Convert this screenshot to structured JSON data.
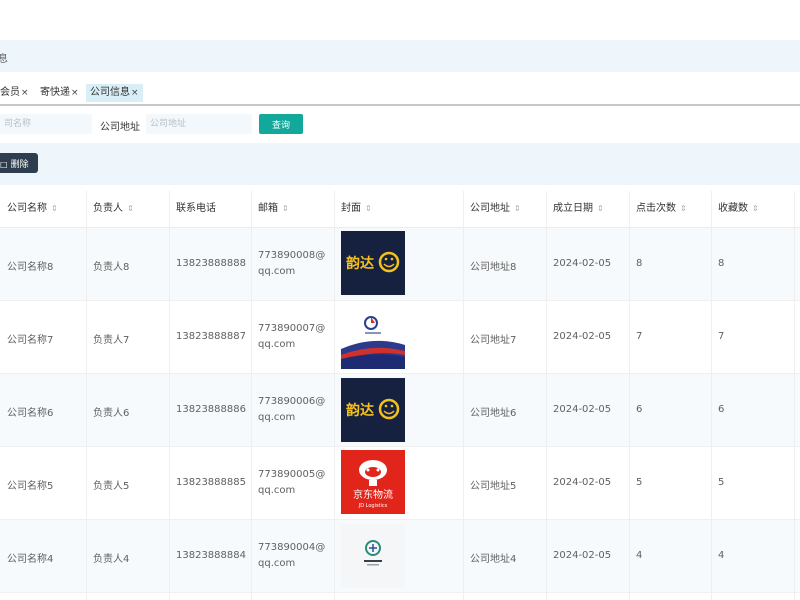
{
  "breadcrumb": "息",
  "tabs": [
    {
      "label": "会员",
      "close": "×"
    },
    {
      "label": "寄快递",
      "close": "×"
    },
    {
      "label": "公司信息",
      "close": "×"
    }
  ],
  "search": {
    "name_placeholder": "司名称",
    "address_label": "公司地址",
    "address_placeholder": "公司地址",
    "query_button": "查询"
  },
  "toolbar": {
    "delete_label": "删除"
  },
  "table": {
    "columns": [
      "公司名称",
      "负责人",
      "联系电话",
      "邮箱",
      "封面",
      "公司地址",
      "成立日期",
      "点击次数",
      "收藏数"
    ],
    "sort_icon": "⇕",
    "rows": [
      {
        "company": "公司名称8",
        "manager": "负责人8",
        "phone": "13823888888",
        "email": "773890008@qq.com",
        "cover": "yunda-logo",
        "address": "公司地址8",
        "date": "2024-02-05",
        "clicks": "8",
        "favorites": "8"
      },
      {
        "company": "公司名称7",
        "manager": "负责人7",
        "phone": "13823888887",
        "email": "773890007@qq.com",
        "cover": "logistics-blue-logo",
        "address": "公司地址7",
        "date": "2024-02-05",
        "clicks": "7",
        "favorites": "7"
      },
      {
        "company": "公司名称6",
        "manager": "负责人6",
        "phone": "13823888886",
        "email": "773890006@qq.com",
        "cover": "yunda-logo",
        "address": "公司地址6",
        "date": "2024-02-05",
        "clicks": "6",
        "favorites": "6"
      },
      {
        "company": "公司名称5",
        "manager": "负责人5",
        "phone": "13823888885",
        "email": "773890005@qq.com",
        "cover": "jd-logistics-logo",
        "address": "公司地址5",
        "date": "2024-02-05",
        "clicks": "5",
        "favorites": "5"
      },
      {
        "company": "公司名称4",
        "manager": "负责人4",
        "phone": "13823888884",
        "email": "773890004@qq.com",
        "cover": "small-green-logo",
        "address": "公司地址4",
        "date": "2024-02-05",
        "clicks": "4",
        "favorites": "4"
      }
    ]
  },
  "logos": {
    "yunda_text": "韵达",
    "jd_text": "京东物流",
    "jd_sub": "JD Logistics"
  },
  "colors": {
    "accent": "#12a89b",
    "delete_button": "#2f3e4f",
    "header_band": "#eef6fc",
    "active_tab": "#d9eef7"
  }
}
